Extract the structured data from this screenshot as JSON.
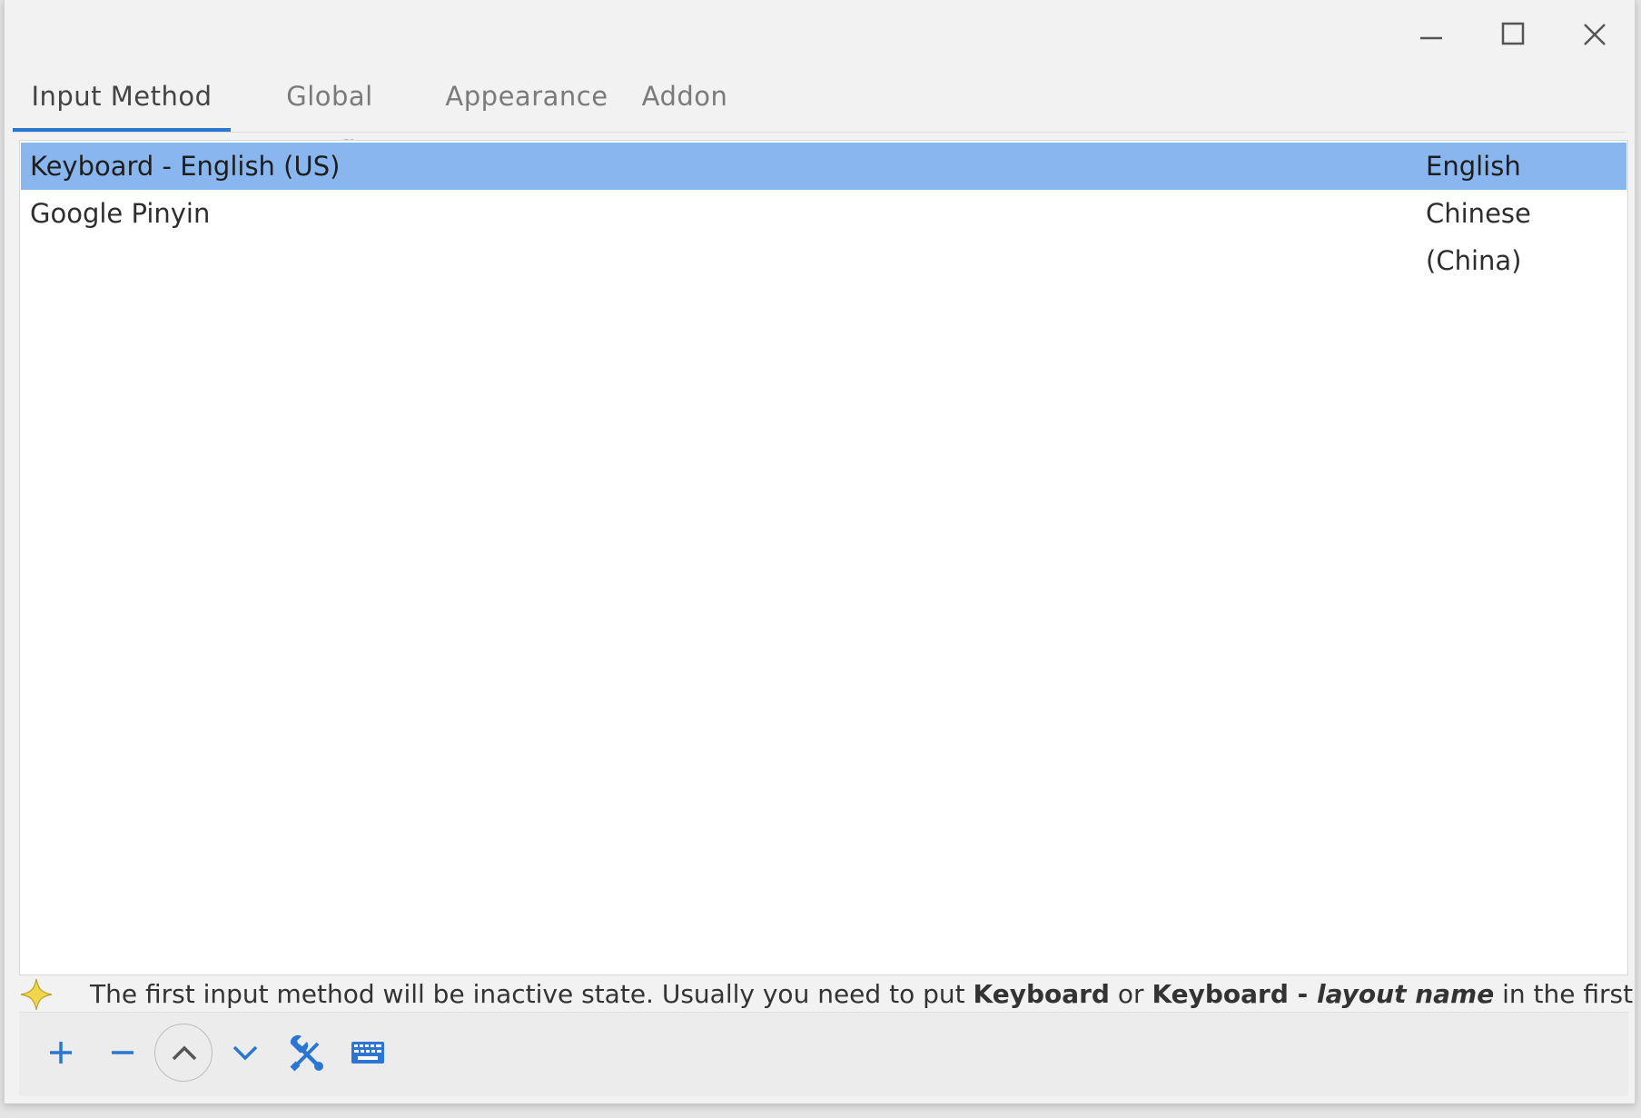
{
  "window": {
    "controls": {
      "minimize_icon": "minimize-icon",
      "maximize_icon": "maximize-icon",
      "close_icon": "close-icon"
    }
  },
  "tabs": [
    {
      "label": "Input Method",
      "active": true
    },
    {
      "label": "Global Config",
      "active": false
    },
    {
      "label": "Appearance",
      "active": false
    },
    {
      "label": "Addon",
      "active": false
    }
  ],
  "input_methods": [
    {
      "name": "Keyboard - English (US)",
      "language": "English",
      "selected": true
    },
    {
      "name": "Google Pinyin",
      "language": "Chinese (China)",
      "selected": false
    }
  ],
  "hint": {
    "text_1": "The first input method will be inactive state. Usually you need to put ",
    "bold_1": "Keyboard",
    "text_2": " or ",
    "bold_2": "Keyboard - ",
    "bold_italic": "layout name",
    "text_3": " in the first place."
  },
  "toolbar": {
    "icons": [
      "add-icon",
      "remove-icon",
      "move-up-icon",
      "move-down-icon",
      "configure-icon",
      "keyboard-layout-icon"
    ]
  },
  "colors": {
    "accent": "#2a76d2",
    "selection": "#8ab6ef",
    "icon_blue": "#2a76d2",
    "star": "#f1d54a"
  }
}
